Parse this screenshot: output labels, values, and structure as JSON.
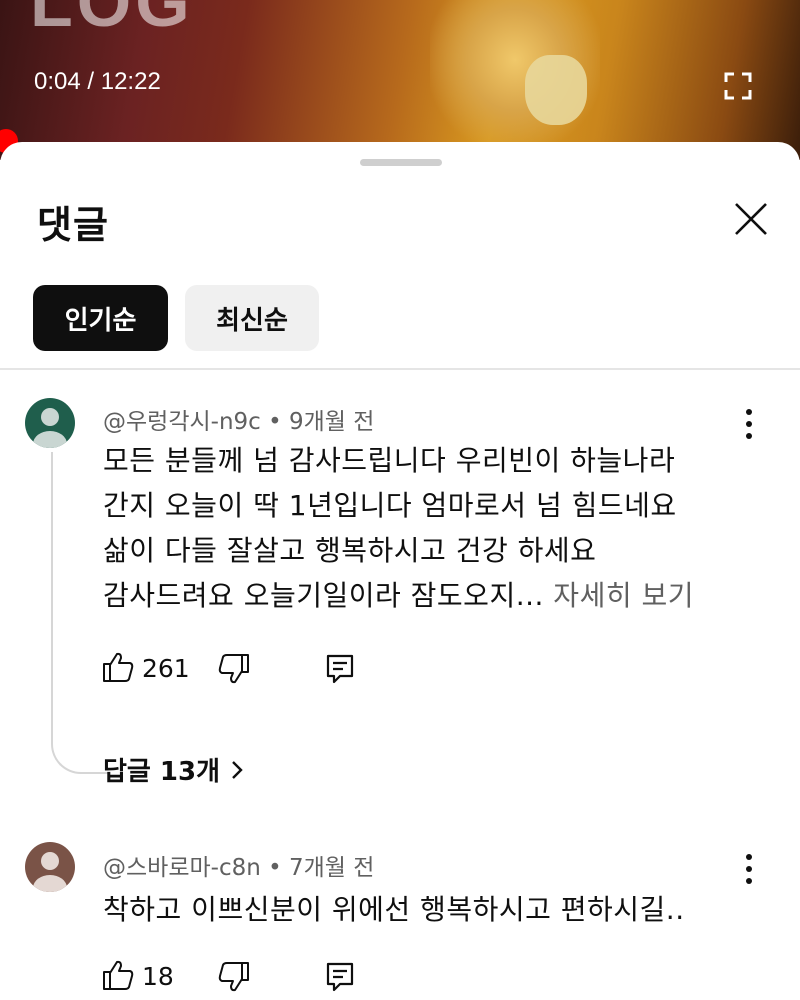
{
  "player": {
    "logo_text": "LOG",
    "current_time": "0:04",
    "separator": " / ",
    "duration": "12:22"
  },
  "panel": {
    "title": "댓글",
    "sort_tabs": [
      {
        "label": "인기순",
        "selected": true
      },
      {
        "label": "최신순",
        "selected": false
      }
    ]
  },
  "comments": [
    {
      "author": "@우렁각시-n9c",
      "time": "9개월 전",
      "lines": [
        "모든 분들께 넘 감사드립니다 우리빈이 하늘나라",
        "간지 오늘이 딱 1년입니다 엄마로서 넘 힘드네요",
        "삶이 다들 잘살고 행복하시고 건강 하세요",
        "감사드려요 오늘기일이라 잠도오지..."
      ],
      "more_label": " 자세히 보기",
      "likes": "261",
      "replies_label": "답글 13개",
      "avatar_color": "#1f5e4c"
    },
    {
      "author": "@스바로마-c8n",
      "time": "7개월 전",
      "lines": [
        "착하고 이쁘신분이 위에선 행복하시고 편하시길.."
      ],
      "likes": "18",
      "avatar_color": "#7a5347"
    }
  ],
  "colors": {
    "progress": "#ff0000",
    "active_chip": "#0f0f0f",
    "inactive_chip": "#f0f0f0",
    "secondary_text": "#606060"
  },
  "icons": [
    "fullscreen-icon",
    "close-icon",
    "more-vert-icon",
    "thumbs-up-icon",
    "thumbs-down-icon",
    "reply-icon",
    "chevron-right-icon"
  ]
}
